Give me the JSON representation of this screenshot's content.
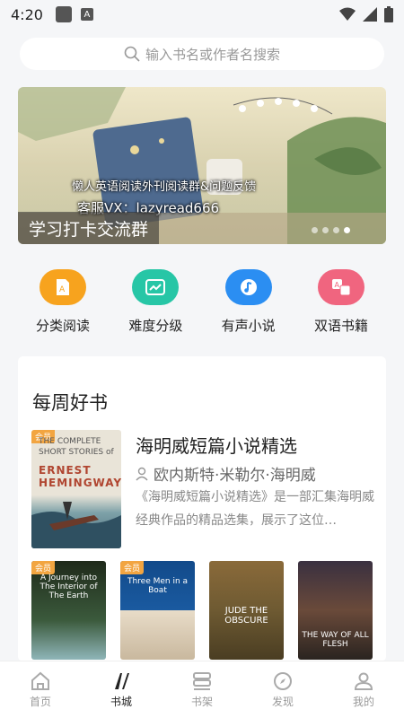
{
  "status_bar": {
    "time": "4:20"
  },
  "search": {
    "placeholder": "输入书名或作者名搜索"
  },
  "banner": {
    "caption": "学习打卡交流群",
    "line1": "懒人英语阅读外刊阅读群&问题反馈",
    "line2": "客服VX：lazyread666"
  },
  "categories": [
    {
      "label": "分类阅读",
      "color": "#f7a31e"
    },
    {
      "label": "难度分级",
      "color": "#27c6a6"
    },
    {
      "label": "有声小说",
      "color": "#2b8ef2"
    },
    {
      "label": "双语书籍",
      "color": "#f0657f"
    }
  ],
  "weekly": {
    "title": "每周好书",
    "featured": {
      "badge": "会员",
      "cover_line1": "THE COMPLETE",
      "cover_line2": "SHORT STORIES of",
      "cover_line3": "ERNEST HEMINGWAY",
      "title": "海明威短篇小说精选",
      "author": "欧内斯特·米勒尔·海明威",
      "description": "《海明威短篇小说精选》是一部汇集海明威经典作品的精品选集，展示了这位…"
    },
    "thumbs": [
      {
        "badge": "会员",
        "text": "A Journey into The Interior of The Earth"
      },
      {
        "badge": "会员",
        "text": "Three Men in a Boat"
      },
      {
        "badge": "",
        "text": "JUDE THE OBSCURE"
      },
      {
        "badge": "",
        "text": "THE WAY OF ALL FLESH"
      }
    ]
  },
  "bottom_nav": [
    {
      "label": "首页",
      "active": false
    },
    {
      "label": "书城",
      "active": true
    },
    {
      "label": "书架",
      "active": false
    },
    {
      "label": "发现",
      "active": false
    },
    {
      "label": "我的",
      "active": false
    }
  ]
}
